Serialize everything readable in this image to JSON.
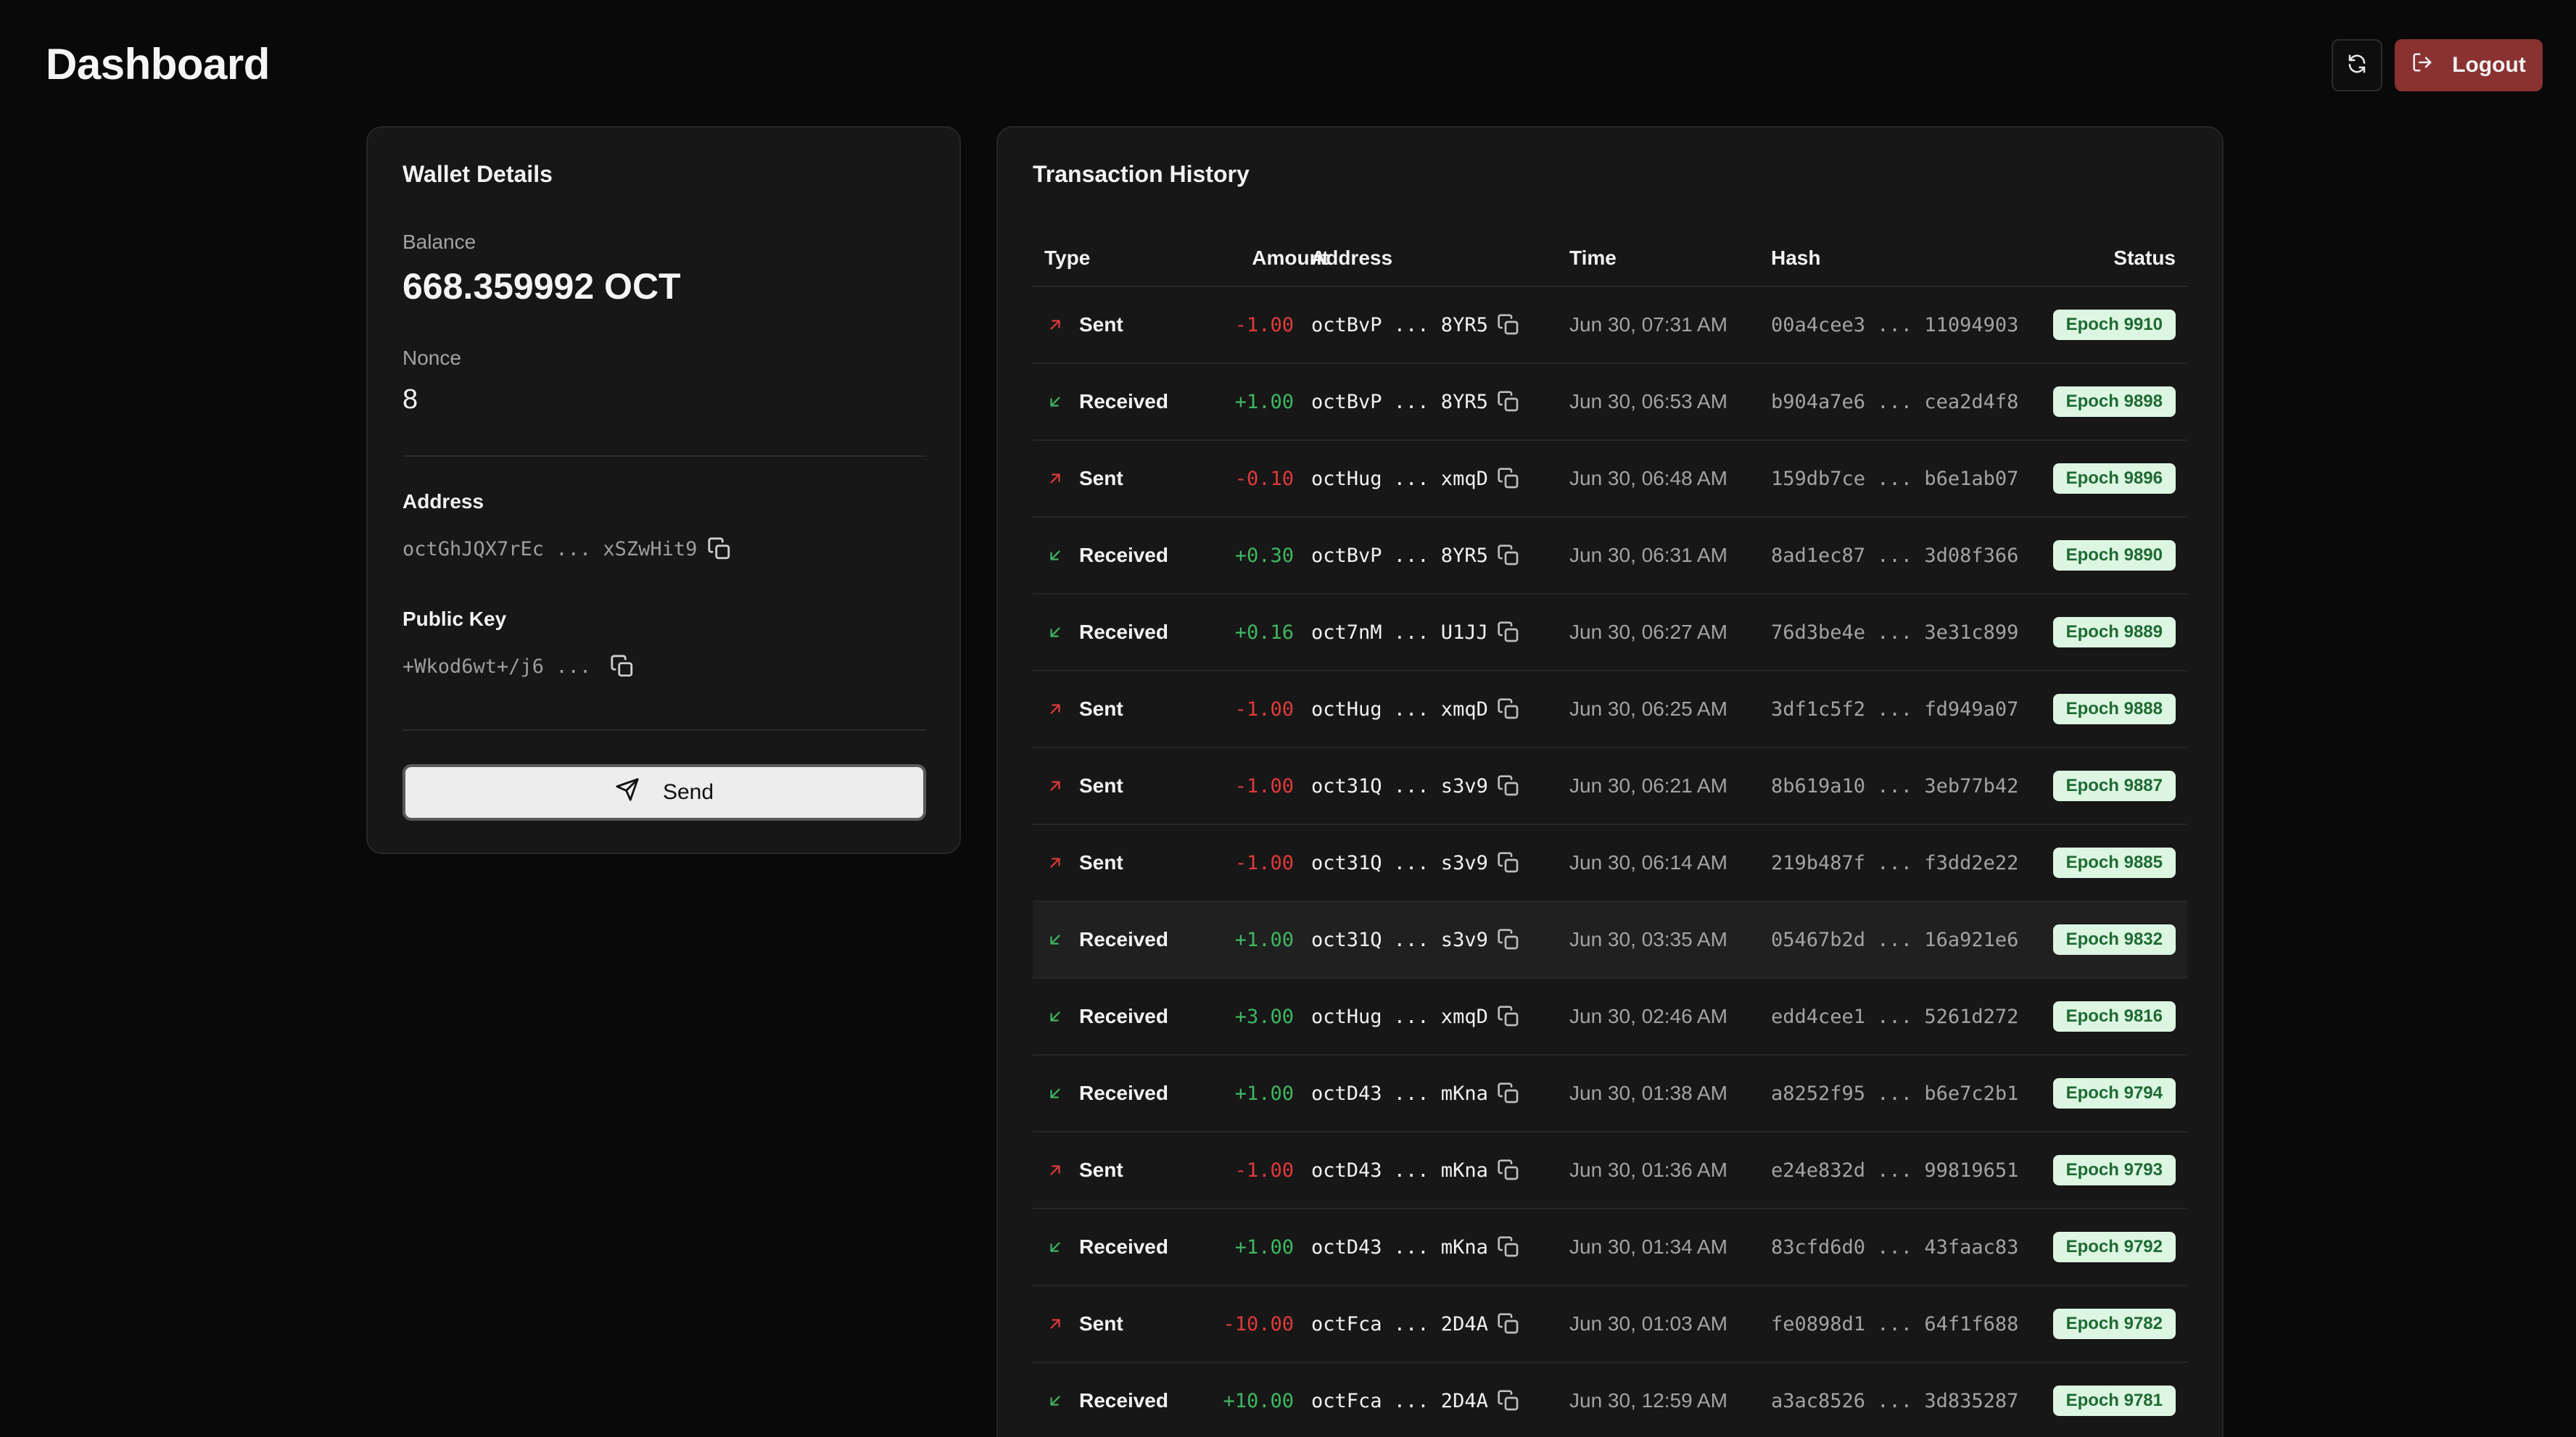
{
  "header": {
    "title": "Dashboard",
    "refresh_icon": "refresh-icon",
    "logout_label": "Logout",
    "logout_icon": "logout-icon"
  },
  "wallet": {
    "title": "Wallet Details",
    "balance_label": "Balance",
    "balance": "668.359992 OCT",
    "nonce_label": "Nonce",
    "nonce": "8",
    "address_label": "Address",
    "address": "octGhJQX7rEc ... xSZwHit9",
    "public_key_label": "Public Key",
    "public_key": "+Wkod6wt+/j6 ...",
    "send_label": "Send"
  },
  "transactions": {
    "title": "Transaction History",
    "columns": {
      "type": "Type",
      "amount": "Amount",
      "address": "Address",
      "time": "Time",
      "hash": "Hash",
      "status": "Status"
    },
    "rows": [
      {
        "type": "Sent",
        "amount": "-1.00",
        "address": "octBvP ... 8YR5",
        "time": "Jun 30, 07:31 AM",
        "hash": "00a4cee3 ... 11094903",
        "status": "Epoch 9910"
      },
      {
        "type": "Received",
        "amount": "+1.00",
        "address": "octBvP ... 8YR5",
        "time": "Jun 30, 06:53 AM",
        "hash": "b904a7e6 ... cea2d4f8",
        "status": "Epoch 9898"
      },
      {
        "type": "Sent",
        "amount": "-0.10",
        "address": "octHug ... xmqD",
        "time": "Jun 30, 06:48 AM",
        "hash": "159db7ce ... b6e1ab07",
        "status": "Epoch 9896"
      },
      {
        "type": "Received",
        "amount": "+0.30",
        "address": "octBvP ... 8YR5",
        "time": "Jun 30, 06:31 AM",
        "hash": "8ad1ec87 ... 3d08f366",
        "status": "Epoch 9890"
      },
      {
        "type": "Received",
        "amount": "+0.16",
        "address": "oct7nM ... U1JJ",
        "time": "Jun 30, 06:27 AM",
        "hash": "76d3be4e ... 3e31c899",
        "status": "Epoch 9889"
      },
      {
        "type": "Sent",
        "amount": "-1.00",
        "address": "octHug ... xmqD",
        "time": "Jun 30, 06:25 AM",
        "hash": "3df1c5f2 ... fd949a07",
        "status": "Epoch 9888"
      },
      {
        "type": "Sent",
        "amount": "-1.00",
        "address": "oct31Q ... s3v9",
        "time": "Jun 30, 06:21 AM",
        "hash": "8b619a10 ... 3eb77b42",
        "status": "Epoch 9887"
      },
      {
        "type": "Sent",
        "amount": "-1.00",
        "address": "oct31Q ... s3v9",
        "time": "Jun 30, 06:14 AM",
        "hash": "219b487f ... f3dd2e22",
        "status": "Epoch 9885"
      },
      {
        "type": "Received",
        "amount": "+1.00",
        "address": "oct31Q ... s3v9",
        "time": "Jun 30, 03:35 AM",
        "hash": "05467b2d ... 16a921e6",
        "status": "Epoch 9832"
      },
      {
        "type": "Received",
        "amount": "+3.00",
        "address": "octHug ... xmqD",
        "time": "Jun 30, 02:46 AM",
        "hash": "edd4cee1 ... 5261d272",
        "status": "Epoch 9816"
      },
      {
        "type": "Received",
        "amount": "+1.00",
        "address": "octD43 ... mKna",
        "time": "Jun 30, 01:38 AM",
        "hash": "a8252f95 ... b6e7c2b1",
        "status": "Epoch 9794"
      },
      {
        "type": "Sent",
        "amount": "-1.00",
        "address": "octD43 ... mKna",
        "time": "Jun 30, 01:36 AM",
        "hash": "e24e832d ... 99819651",
        "status": "Epoch 9793"
      },
      {
        "type": "Received",
        "amount": "+1.00",
        "address": "octD43 ... mKna",
        "time": "Jun 30, 01:34 AM",
        "hash": "83cfd6d0 ... 43faac83",
        "status": "Epoch 9792"
      },
      {
        "type": "Sent",
        "amount": "-10.00",
        "address": "octFca ... 2D4A",
        "time": "Jun 30, 01:03 AM",
        "hash": "fe0898d1 ... 64f1f688",
        "status": "Epoch 9782"
      },
      {
        "type": "Received",
        "amount": "+10.00",
        "address": "octFca ... 2D4A",
        "time": "Jun 30, 12:59 AM",
        "hash": "a3ac8526 ... 3d835287",
        "status": "Epoch 9781"
      }
    ]
  },
  "colors": {
    "background": "#090909",
    "card": "#171717",
    "sent": "#e0393b",
    "received": "#3fb760",
    "badge_bg": "#dcf6e2",
    "badge_text": "#1f6a33",
    "logout": "#8a3131"
  }
}
